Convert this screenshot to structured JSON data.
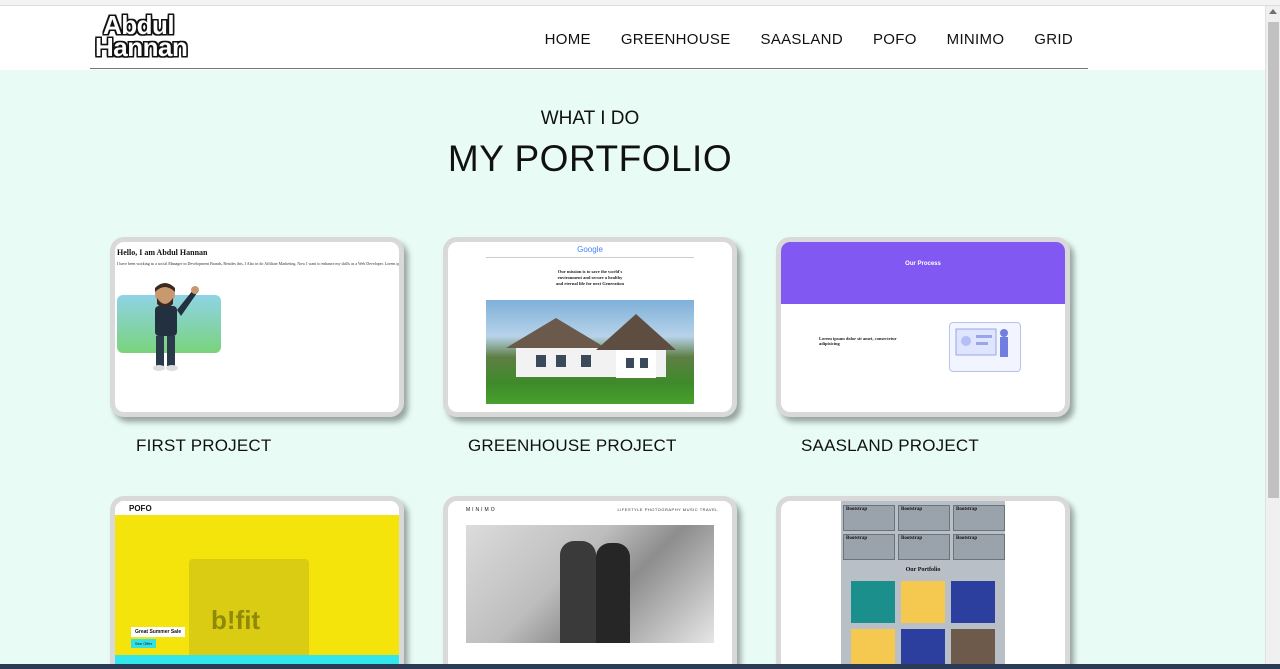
{
  "header": {
    "logo_line1": "Abdul",
    "logo_line2": "Hannan",
    "nav": [
      "HOME",
      "GREENHOUSE",
      "SAASLAND",
      "POFO",
      "MINIMO",
      "GRID"
    ]
  },
  "hero": {
    "kicker": "WHAT I DO",
    "title": "MY PORTFOLIO"
  },
  "projects": [
    {
      "label": "FIRST PROJECT"
    },
    {
      "label": "GREENHOUSE PROJECT"
    },
    {
      "label": "SAASLAND PROJECT"
    },
    {
      "label": ""
    },
    {
      "label": ""
    },
    {
      "label": ""
    }
  ],
  "thumbs": {
    "first": {
      "heading": "Hello, I am Abdul Hannan",
      "text": "I have been working as a social Manager in Development Brands, Besides this, I Also in do Affiliate Marketing. Now I want to enhance my skills as a Web Developer. Lorem ipsum"
    },
    "greenhouse": {
      "google": "Google",
      "line1": "Our mission is to save the world's",
      "line2": "environment and secure a healthy",
      "line3": "and eternal life for next Generation"
    },
    "saasland": {
      "band_title": "Our Process",
      "lead": "Lorem ipsum dolor sit amet, consectetur adipisicing"
    },
    "pofo": {
      "logo": "POFO",
      "sale": "Great Summer Sale",
      "button": "See Offer",
      "bag_text": "b!fit"
    },
    "minimo": {
      "brand": "MINIMO",
      "menu": "LIFESTYLE   PHOTOGRAPHY   MUSIC   TRAVEL"
    },
    "grid": {
      "cell": "Bootstrap",
      "heading": "Our Portfolio"
    }
  },
  "colors": {
    "main_bg": "#e8fbf5",
    "saasland_purple": "#8159f2",
    "pofo_yellow": "#f4e40c"
  }
}
